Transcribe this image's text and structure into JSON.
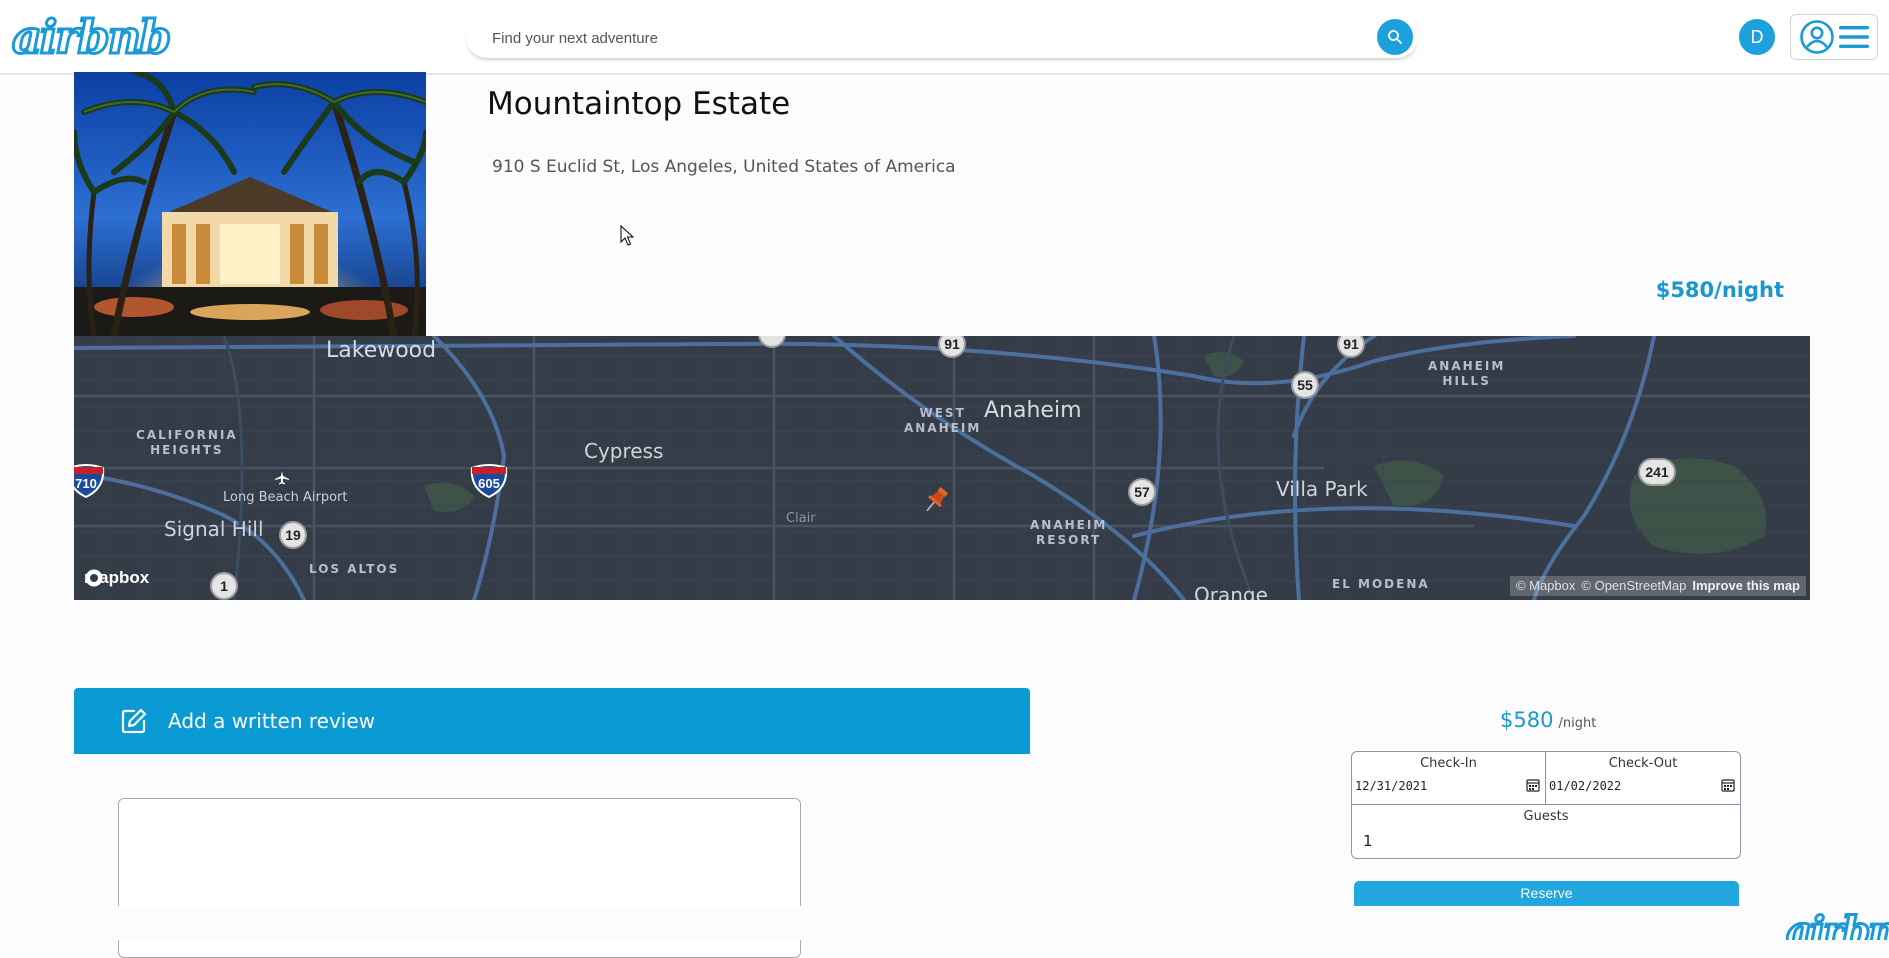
{
  "brand": {
    "logo_text": "airbnb",
    "accent": "#1a9ad6"
  },
  "search": {
    "placeholder": "Find your next adventure",
    "icon": "search-icon"
  },
  "user": {
    "avatar_initial": "D",
    "icons": [
      "user-circle-icon",
      "hamburger-menu-icon"
    ]
  },
  "listing": {
    "title": "Mountaintop Estate",
    "address": "910 S Euclid St, Los Angeles, United States of America",
    "price_label": "$580/night"
  },
  "map": {
    "labels": {
      "lakewood": "Lakewood",
      "california_heights": "CALIFORNIA\nHEIGHTS",
      "long_beach_airport": "Long Beach Airport",
      "signal_hill": "Signal Hill",
      "los_altos": "LOS ALTOS",
      "cypress": "Cypress",
      "clair": "Clair",
      "west_anaheim": "WEST\nANAHEIM",
      "anaheim": "Anaheim",
      "anaheim_resort": "ANAHEIM\nRESORT",
      "villa_park": "Villa Park",
      "anaheim_hills": "ANAHEIM\nHILLS",
      "el_modena": "EL MODENA",
      "orange": "Orange"
    },
    "shields": [
      "91",
      "91",
      "55",
      "57",
      "241",
      "19",
      "1",
      "710",
      "605"
    ],
    "mapbox_logo": "mapbox",
    "attribution": {
      "mapbox": "© Mapbox",
      "osm": "© OpenStreetMap",
      "improve": "Improve this map"
    }
  },
  "review": {
    "button_label": "Add a written review",
    "icon": "edit-icon"
  },
  "booking": {
    "price": "$580",
    "per_night": "/night",
    "checkin_label": "Check-In",
    "checkin_value": "12/31/2021",
    "checkout_label": "Check-Out",
    "checkout_value": "01/02/2022",
    "guests_label": "Guests",
    "guests_value": "1",
    "reserve_label": "Reserve"
  },
  "footer": {
    "logo_text": "airbnb"
  }
}
